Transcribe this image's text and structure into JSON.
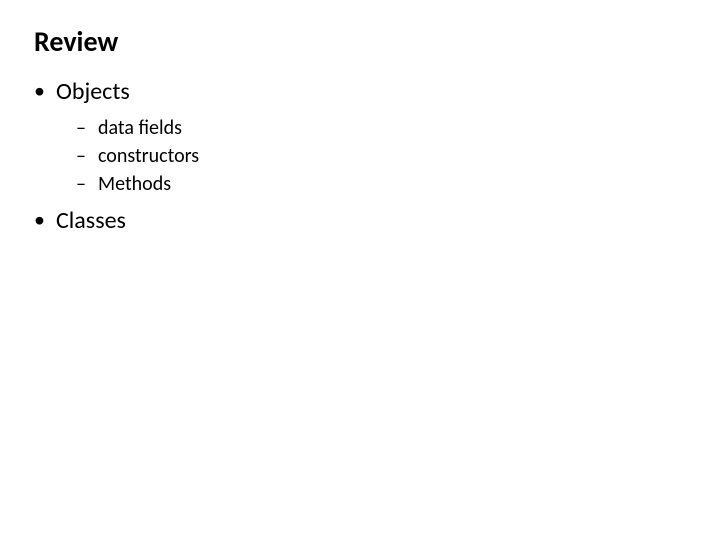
{
  "title": "Review",
  "bullets": {
    "b1": {
      "label": "Objects",
      "subs": {
        "s1": "data fields",
        "s2": "constructors",
        "s3": "Methods"
      }
    },
    "b2": {
      "label": "Classes"
    }
  }
}
